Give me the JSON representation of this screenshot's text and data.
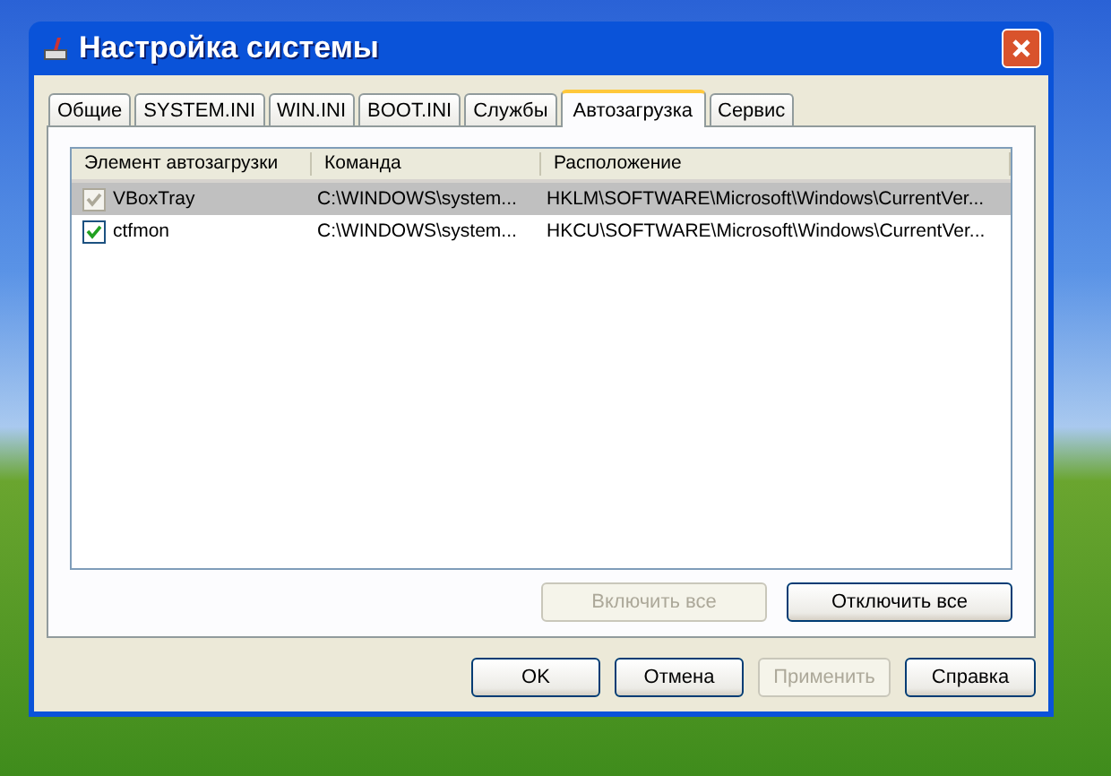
{
  "window": {
    "title": "Настройка системы"
  },
  "tabs": [
    {
      "label": "Общие",
      "selected": false
    },
    {
      "label": "SYSTEM.INI",
      "selected": false
    },
    {
      "label": "WIN.INI",
      "selected": false
    },
    {
      "label": "BOOT.INI",
      "selected": false
    },
    {
      "label": "Службы",
      "selected": false
    },
    {
      "label": "Автозагрузка",
      "selected": true
    },
    {
      "label": "Сервис",
      "selected": false
    }
  ],
  "table": {
    "columns": [
      "Элемент автозагрузки",
      "Команда",
      "Расположение"
    ],
    "rows": [
      {
        "checked": true,
        "disabled": true,
        "selected": true,
        "cells": [
          "VBoxTray",
          "C:\\WINDOWS\\system...",
          "HKLM\\SOFTWARE\\Microsoft\\Windows\\CurrentVer..."
        ]
      },
      {
        "checked": true,
        "disabled": false,
        "selected": false,
        "cells": [
          "ctfmon",
          "C:\\WINDOWS\\system...",
          "HKCU\\SOFTWARE\\Microsoft\\Windows\\CurrentVer..."
        ]
      }
    ]
  },
  "panel_buttons": [
    {
      "label": "Включить все",
      "disabled": true
    },
    {
      "label": "Отключить все",
      "disabled": false
    }
  ],
  "dialog_buttons": [
    {
      "label": "OK",
      "disabled": false
    },
    {
      "label": "Отмена",
      "disabled": false
    },
    {
      "label": "Применить",
      "disabled": true
    },
    {
      "label": "Справка",
      "disabled": false
    }
  ]
}
